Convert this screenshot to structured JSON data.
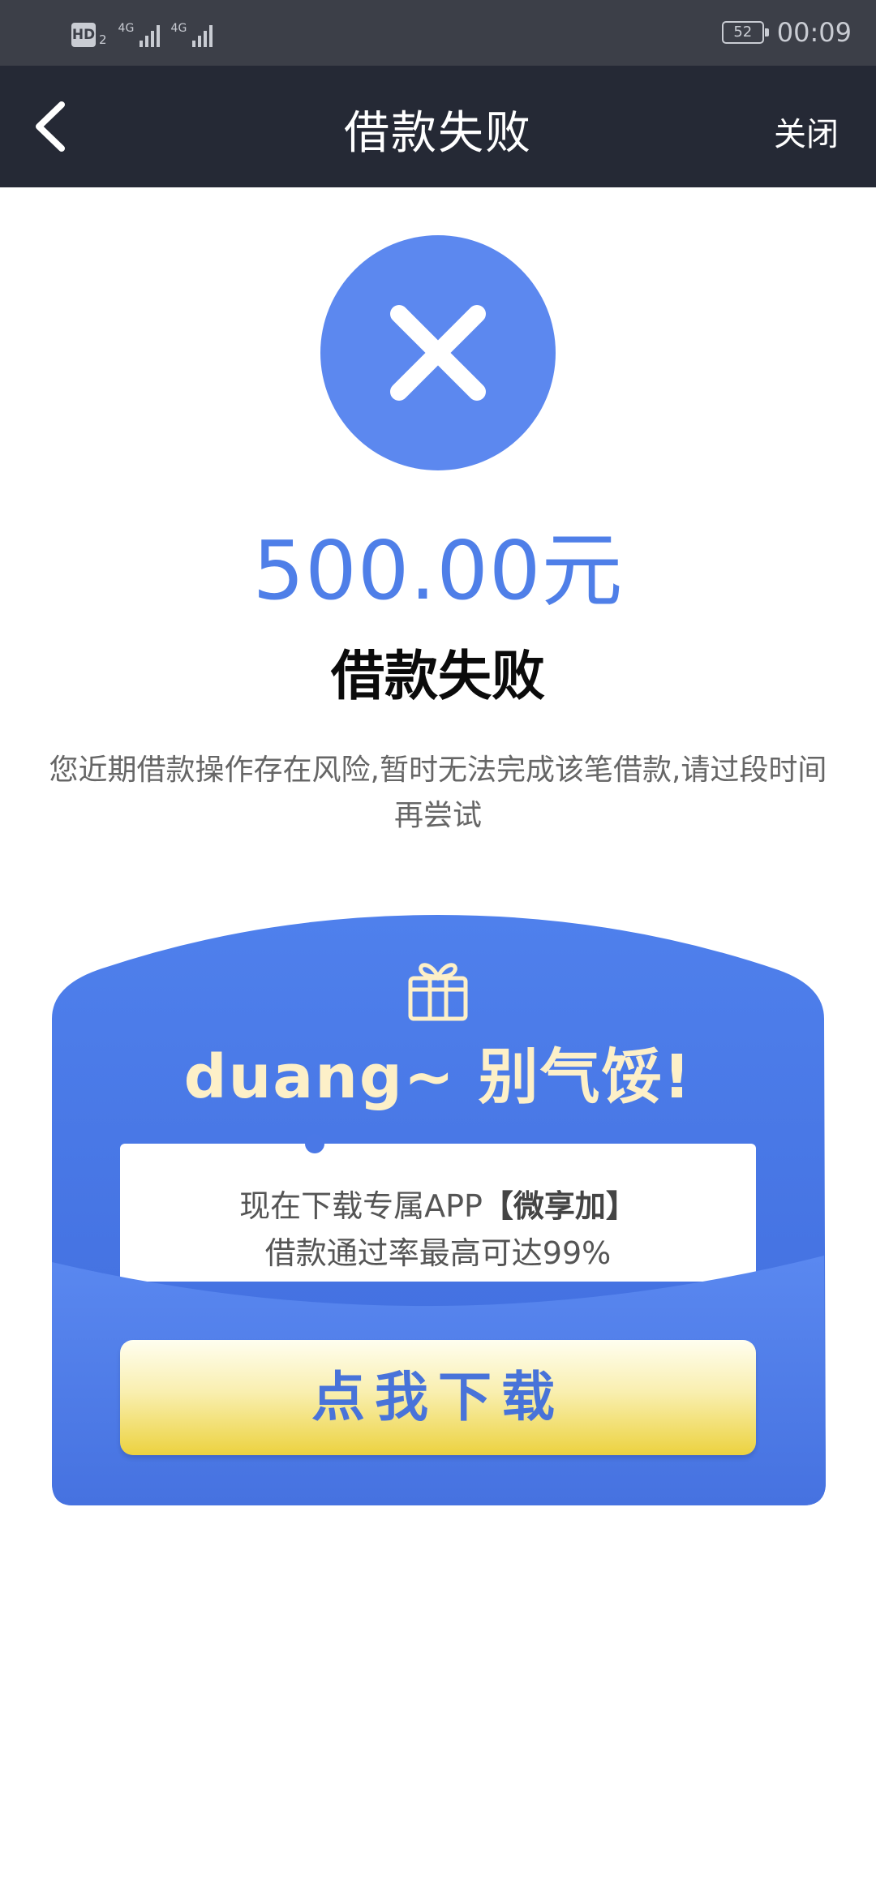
{
  "status_bar": {
    "hd_label": "HD",
    "hd_sub": "2",
    "network_1": "4G",
    "network_2": "4G",
    "battery": "52",
    "time": "00:09"
  },
  "nav": {
    "back_icon": "chevron-left-icon",
    "title": "借款失败",
    "close_label": "关闭"
  },
  "result": {
    "icon": "close-x-icon",
    "amount": "500.00元",
    "title": "借款失败",
    "description": "您近期借款操作存在风险,暂时无法完成该笔借款,请过段时间再尝试"
  },
  "promo": {
    "icon": "gift-icon",
    "headline": "duang~ 别气馁!",
    "note_line1_prefix": "现在下载专属APP",
    "note_line1_app": "【微享加】",
    "note_line2": "借款通过率最高可达99%",
    "button_label": "点我下载"
  },
  "colors": {
    "nav_bg": "#252935",
    "status_bg": "#3c3f48",
    "accent_blue": "#5c88ef",
    "amount_blue": "#4f7fe8",
    "promo_blue": "#4a78e6",
    "button_yellow": "#ecd23f",
    "headline_cream": "#fdf0c8"
  }
}
